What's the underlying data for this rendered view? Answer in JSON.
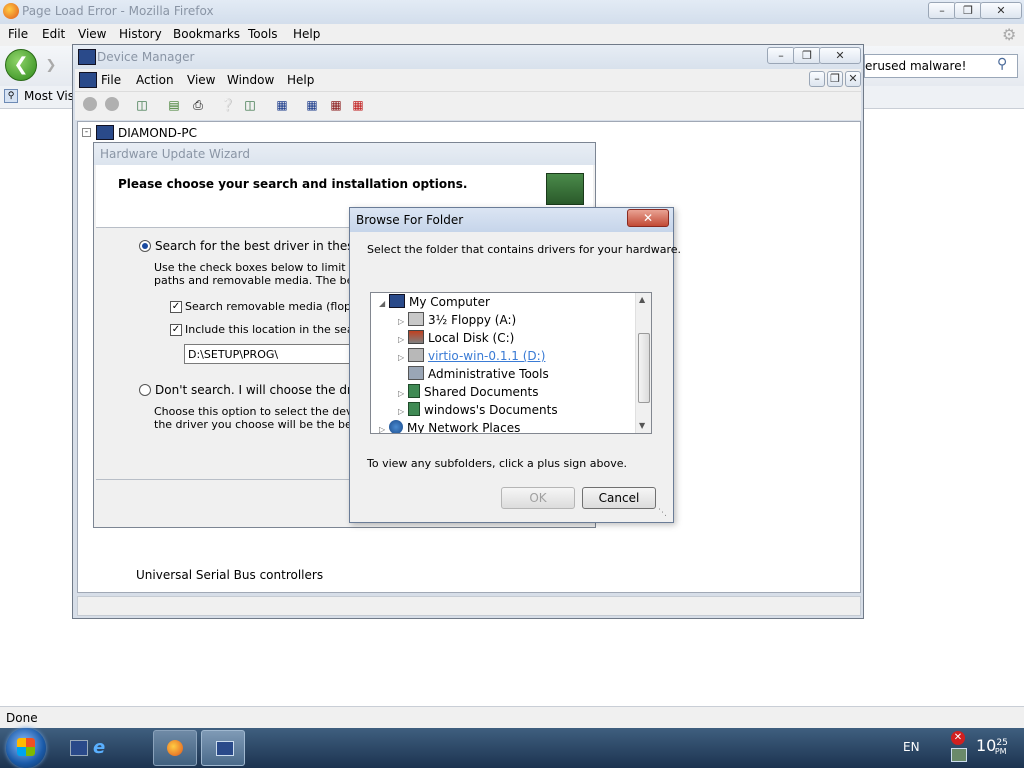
{
  "firefox": {
    "title": "Page Load Error - Mozilla Firefox",
    "menu": [
      "File",
      "Edit",
      "View",
      "History",
      "Bookmarks",
      "Tools",
      "Help"
    ],
    "search_value": "erused malware!",
    "bookmark": "Most Visi",
    "status": "Done"
  },
  "device_manager": {
    "title": "Device Manager",
    "menu": [
      "File",
      "Action",
      "View",
      "Window",
      "Help"
    ],
    "tree_root": "DIAMOND-PC",
    "tree_item_hidden": "Universal Serial Bus controllers"
  },
  "wizard": {
    "title": "Hardware Update Wizard",
    "heading": "Please choose your search and installation options.",
    "radio_search": "Search for the best driver in these locatio",
    "search_desc": "Use the check boxes below to limit or exp",
    "search_desc2": "paths and removable media. The best driv",
    "check_removable": "Search removable media (floppy, C",
    "check_include": "Include this location in the search:",
    "path_value": "D:\\SETUP\\PROG\\",
    "radio_dont": "Don't search. I will choose the driver to in",
    "dont_desc": "Choose this option to select the device dr",
    "dont_desc2": "the driver you choose will be the best mat"
  },
  "browse": {
    "title": "Browse For Folder",
    "instruction": "Select the folder that contains drivers for your hardware.",
    "tree": [
      {
        "label": "My Computer",
        "icon": "computer-icon"
      },
      {
        "label": "3½ Floppy (A:)",
        "icon": "floppy-icon"
      },
      {
        "label": "Local Disk (C:)",
        "icon": "disk-icon"
      },
      {
        "label": "virtio-win-0.1.1 (D:)",
        "icon": "cd-drive-icon"
      },
      {
        "label": "Administrative Tools",
        "icon": "tools-icon"
      },
      {
        "label": "Shared Documents",
        "icon": "folder-icon"
      },
      {
        "label": "windows's Documents",
        "icon": "folder-icon"
      },
      {
        "label": "My Network Places",
        "icon": "network-icon"
      }
    ],
    "hint": "To view any subfolders, click a plus sign above.",
    "ok": "OK",
    "cancel": "Cancel"
  },
  "taskbar": {
    "lang": "EN",
    "time_hour": "10",
    "time_min": "25",
    "time_ampm": "PM"
  }
}
